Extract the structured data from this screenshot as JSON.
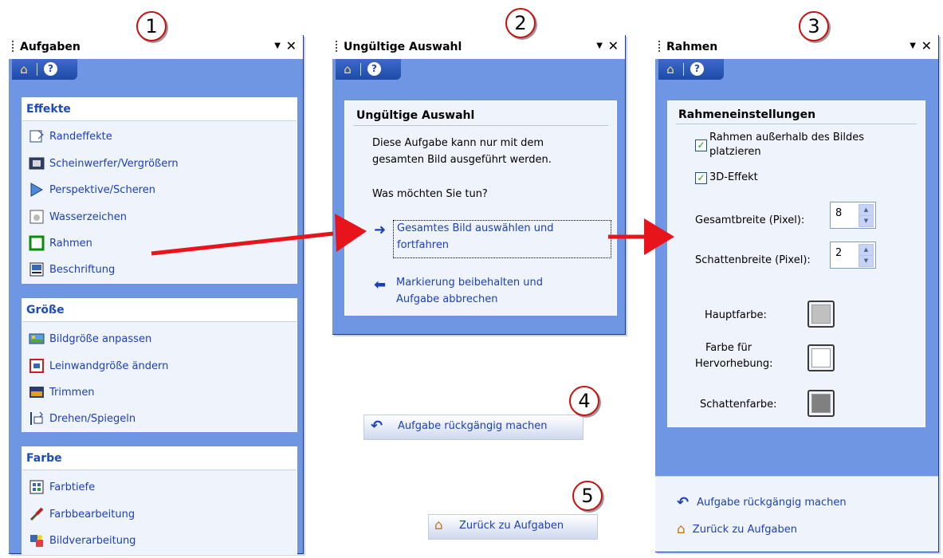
{
  "pane1": {
    "title": "Aufgaben",
    "callout": "1",
    "groups": [
      {
        "header": "Effekte",
        "items": [
          "Randeffekte",
          "Scheinwerfer/Vergrößern",
          "Perspektive/Scheren",
          "Wasserzeichen",
          "Rahmen",
          "Beschriftung"
        ]
      },
      {
        "header": "Größe",
        "items": [
          "Bildgröße anpassen",
          "Leinwandgröße ändern",
          "Trimmen",
          "Drehen/Spiegeln"
        ]
      },
      {
        "header": "Farbe",
        "items": [
          "Farbtiefe",
          "Farbbearbeitung",
          "Bildverarbeitung"
        ]
      }
    ]
  },
  "pane2": {
    "title": "Ungültige Auswahl",
    "callout": "2",
    "box_header": "Ungültige Auswahl",
    "message_line1": "Diese Aufgabe kann nur mit dem",
    "message_line2": "gesamten Bild ausgeführt werden.",
    "question": "Was möchten Sie tun?",
    "option1_line1": "Gesamtes Bild auswählen und",
    "option1_line2": "fortfahren",
    "option2_line1": "Markierung beibehalten und",
    "option2_line2": "Aufgabe abbrechen"
  },
  "pane3": {
    "title": "Rahmen",
    "callout": "3",
    "box_header": "Rahmeneinstellungen",
    "check1_line1": "Rahmen außerhalb des Bildes",
    "check1_line2": "platzieren",
    "check2": "3D-Effekt",
    "total_width_label": "Gesamtbreite (Pixel):",
    "total_width_value": "8",
    "shadow_width_label": "Schattenbreite (Pixel):",
    "shadow_width_value": "2",
    "main_color_label": "Hauptfarbe:",
    "highlight_color_line1": "Farbe für",
    "highlight_color_line2": "Hervorhebung:",
    "shadow_color_label": "Schattenfarbe:",
    "undo_link": "Aufgabe rückgängig machen",
    "back_link": "Zurück zu Aufgaben",
    "colors": {
      "main": "#c0c0c0",
      "highlight": "#ffffff",
      "shadow": "#808080"
    }
  },
  "button_undo": {
    "label": "Aufgabe rückgängig machen",
    "callout": "4"
  },
  "button_back": {
    "label": "Zurück zu Aufgaben",
    "callout": "5"
  },
  "colors": {
    "pane_bg": "#6f96e2",
    "link": "#1d3fb8",
    "arrow": "#e8141c",
    "callout_ring": "#c81010"
  },
  "icons": {
    "home": "home-icon",
    "help": "help-icon",
    "close": "close-icon",
    "dropdown": "dropdown-arrow-icon"
  }
}
